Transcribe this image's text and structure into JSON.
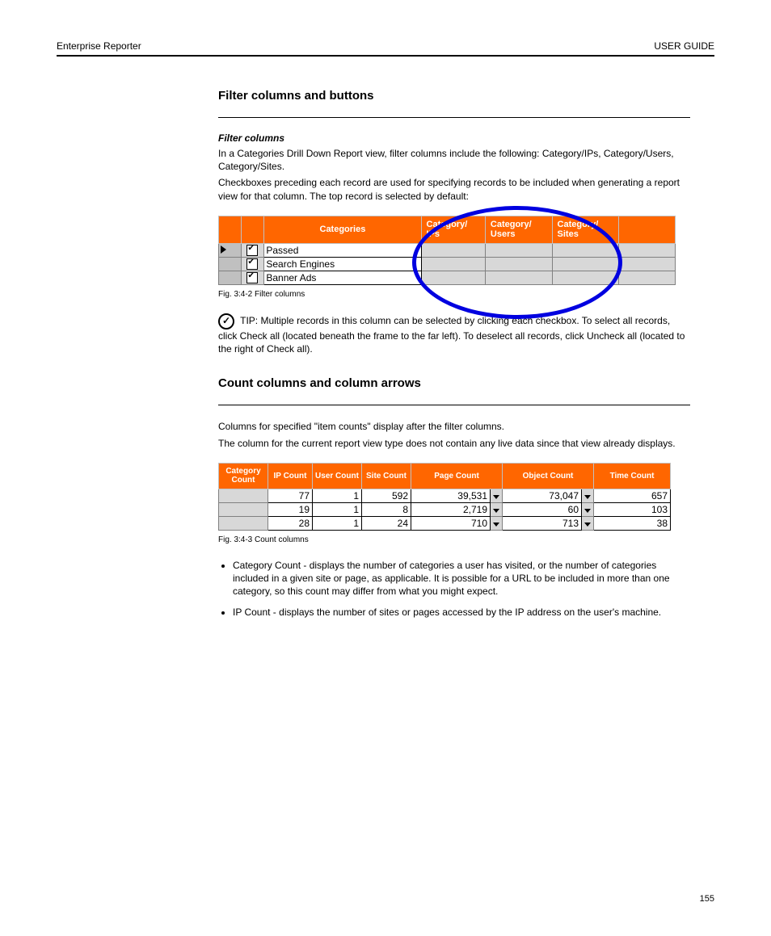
{
  "header": {
    "left": "Enterprise Reporter",
    "right": "USER GUIDE"
  },
  "section1": {
    "title": "Filter columns and buttons",
    "subtitle": "Filter columns",
    "para1": "In a Categories Drill Down Report view, filter columns include the following: Category/IPs, Category/Users, Category/Sites.",
    "para2": "Checkboxes preceding each record are used for specifying records to be included when generating a report view for that column. The top record is selected by default:",
    "figcaption": "Fig. 3:4-2  Filter columns"
  },
  "categoriesTable": {
    "headers": {
      "categories": "Categories",
      "ips": "Category/ IPs",
      "users": "Category/ Users",
      "sites": "Category/ Sites"
    },
    "rows": [
      {
        "name": "Passed",
        "selected": true
      },
      {
        "name": "Search Engines",
        "selected": false
      },
      {
        "name": "Banner Ads",
        "selected": false
      }
    ]
  },
  "tip": "TIP: Multiple records in this column can be selected by clicking each checkbox. To select all records, click Check all (located beneath the frame to the far left). To deselect all records, click Uncheck all (located to the right of Check all).",
  "section2": {
    "title": "Count columns and column arrows",
    "para1": "Columns for specified \"item counts\" display after the filter columns.",
    "para2": "The column for the current report view type does not contain any live data since that view already displays.",
    "figcaption": "Fig. 3:4-3  Count columns"
  },
  "countsTable": {
    "headers": {
      "category": "Category Count",
      "ip": "IP Count",
      "user": "User Count",
      "site": "Site Count",
      "page": "Page Count",
      "object": "Object Count",
      "time": "Time Count"
    },
    "rows": [
      {
        "category": "",
        "ip": "77",
        "user": "1",
        "site": "592",
        "page": "39,531",
        "object": "73,047",
        "time": "657"
      },
      {
        "category": "",
        "ip": "19",
        "user": "1",
        "site": "8",
        "page": "2,719",
        "object": "60",
        "time": "103"
      },
      {
        "category": "",
        "ip": "28",
        "user": "1",
        "site": "24",
        "page": "710",
        "object": "713",
        "time": "38"
      }
    ]
  },
  "bullets": [
    "Category Count - displays the number of categories a user has visited, or the number of categories included in a given site or page, as applicable. It is possible for a URL to be included in more than one category, so this count may differ from what you might expect.",
    "IP Count - displays the number of sites or pages accessed by the IP address on the user's machine."
  ],
  "pageNumber": "155"
}
